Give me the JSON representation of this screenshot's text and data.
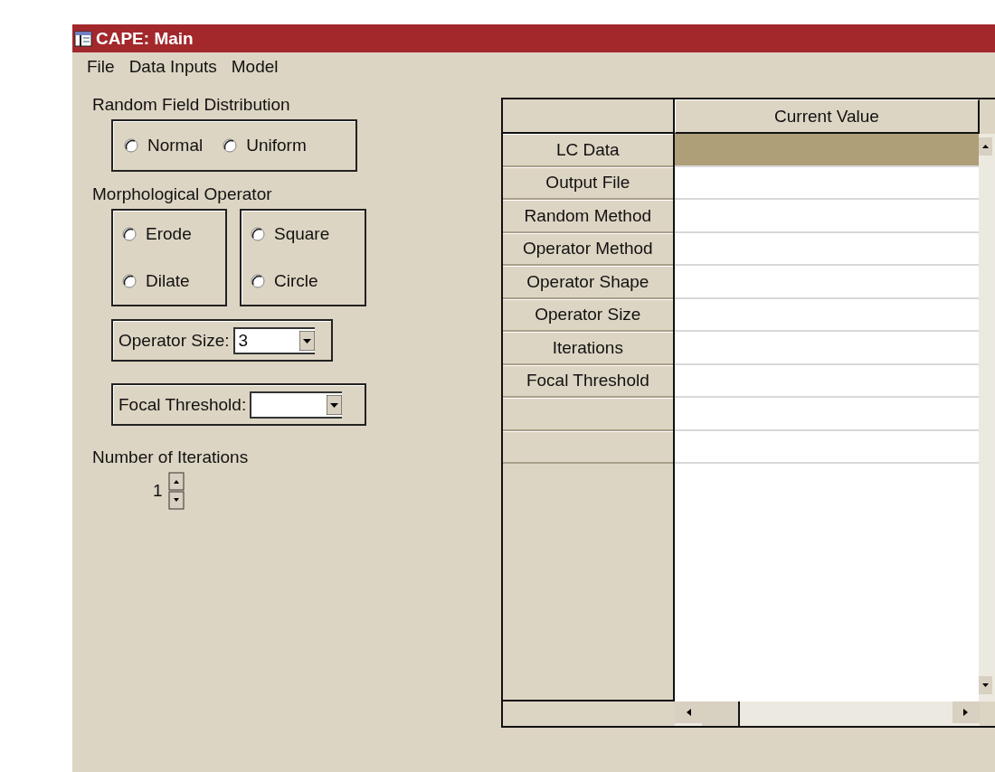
{
  "window": {
    "title": "CAPE: Main"
  },
  "menu": [
    "File",
    "Data Inputs",
    "Model"
  ],
  "random_field_distribution": {
    "label": "Random Field Distribution",
    "options": [
      {
        "label": "Normal",
        "selected": false
      },
      {
        "label": "Uniform",
        "selected": false
      }
    ]
  },
  "morphological_operator": {
    "label": "Morphological Operator",
    "groups": [
      [
        {
          "label": "Erode",
          "selected": false
        },
        {
          "label": "Dilate",
          "selected": false
        }
      ],
      [
        {
          "label": "Square",
          "selected": false
        },
        {
          "label": "Circle",
          "selected": false
        }
      ]
    ]
  },
  "operator_size": {
    "label": "Operator Size:",
    "value": "3"
  },
  "focal_threshold": {
    "label": "Focal Threshold:"
  },
  "iterations": {
    "label": "Number of Iterations",
    "value": "1"
  },
  "grid": {
    "columns": [
      "Current Value"
    ],
    "rows": [
      {
        "label": "LC Data",
        "selected": true
      },
      {
        "label": "Output File",
        "selected": false
      },
      {
        "label": "Random Method",
        "selected": false
      },
      {
        "label": "Operator Method",
        "selected": false
      },
      {
        "label": "Operator Shape",
        "selected": false
      },
      {
        "label": "Operator Size",
        "selected": false
      },
      {
        "label": "Iterations",
        "selected": false
      },
      {
        "label": "Focal Threshold",
        "selected": false
      },
      {
        "selected": false
      },
      {
        "selected": false
      }
    ]
  }
}
